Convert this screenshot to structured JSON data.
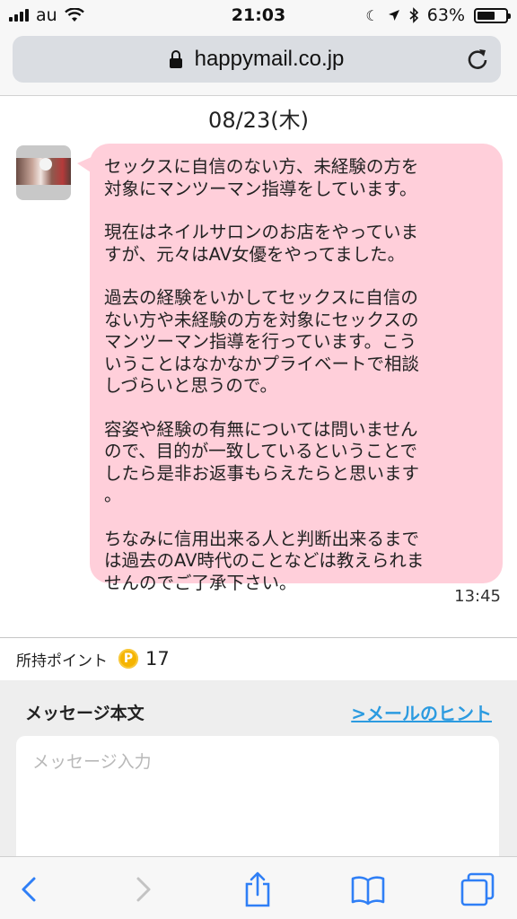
{
  "status_bar": {
    "carrier": "au",
    "time": "21:03",
    "battery": "63%",
    "battery_level": 0.63
  },
  "browser": {
    "url": "happymail.co.jp"
  },
  "chat": {
    "date": "08/23(木)",
    "message": {
      "paragraphs": [
        "セックスに自信のない方、未経験の方を\n対象にマンツーマン指導をしています。",
        "現在はネイルサロンのお店をやっていま\nすが、元々はAV女優をやってました。",
        "過去の経験をいかしてセックスに自信の\nない方や未経験の方を対象にセックスの\nマンツーマン指導を行っています。こう\nいうことはなかなかプライベートで相談\nしづらいと思うので。",
        "容姿や経験の有無については問いません\nので、目的が一致しているということで\nしたら是非お返事もらえたらと思います\n。",
        "ちなみに信用出来る人と判断出来るまで\nは過去のAV時代のことなどは教えられま\nせんのでご了承下さい。"
      ],
      "time": "13:45"
    }
  },
  "points": {
    "label": "所持ポイント",
    "coin": "P",
    "value": "17"
  },
  "compose": {
    "title": "メッセージ本文",
    "hint_link": ">メールのヒント",
    "placeholder": "メッセージ入力"
  },
  "colors": {
    "bubble": "#ffcfda",
    "link": "#2c9be0",
    "coin": "#f5b400",
    "toolbar_icon": "#2f7ff6"
  }
}
